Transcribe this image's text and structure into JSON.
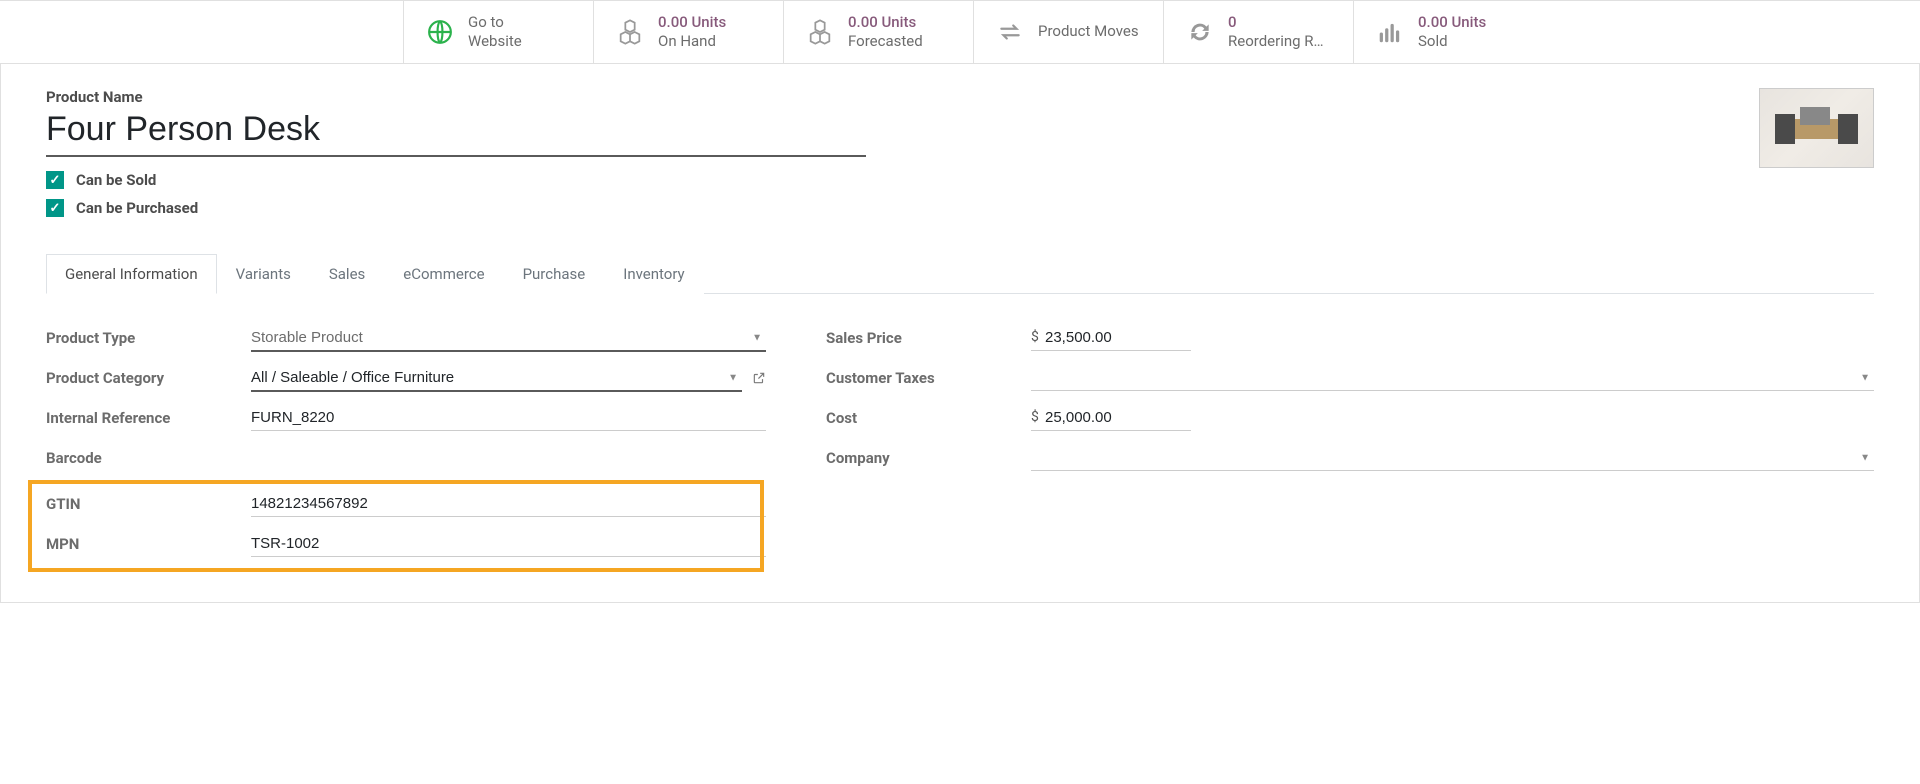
{
  "stats": {
    "go_website": {
      "line1": "Go to",
      "line2": "Website"
    },
    "on_hand": {
      "value": "0.00 Units",
      "label": "On Hand"
    },
    "forecasted": {
      "value": "0.00 Units",
      "label": "Forecasted"
    },
    "product_moves": {
      "label": "Product Moves"
    },
    "reordering": {
      "value": "0",
      "label": "Reordering R…"
    },
    "sold": {
      "value": "0.00 Units",
      "label": "Sold"
    }
  },
  "heading": {
    "label": "Product Name",
    "value": "Four Person Desk"
  },
  "checkboxes": {
    "can_sell": "Can be Sold",
    "can_purchase": "Can be Purchased"
  },
  "tabs": {
    "general": "General Information",
    "variants": "Variants",
    "sales": "Sales",
    "ecommerce": "eCommerce",
    "purchase": "Purchase",
    "inventory": "Inventory"
  },
  "left": {
    "product_type": {
      "label": "Product Type",
      "value": "Storable Product"
    },
    "category": {
      "label": "Product Category",
      "value": "All / Saleable / Office Furniture"
    },
    "internal_ref": {
      "label": "Internal Reference",
      "value": "FURN_8220"
    },
    "barcode": {
      "label": "Barcode",
      "value": ""
    },
    "gtin": {
      "label": "GTIN",
      "value": "14821234567892"
    },
    "mpn": {
      "label": "MPN",
      "value": "TSR-1002"
    }
  },
  "right": {
    "sales_price": {
      "label": "Sales Price",
      "currency": "$",
      "value": "23,500.00"
    },
    "customer_taxes": {
      "label": "Customer Taxes",
      "value": ""
    },
    "cost": {
      "label": "Cost",
      "currency": "$",
      "value": "25,000.00"
    },
    "company": {
      "label": "Company",
      "value": ""
    }
  }
}
